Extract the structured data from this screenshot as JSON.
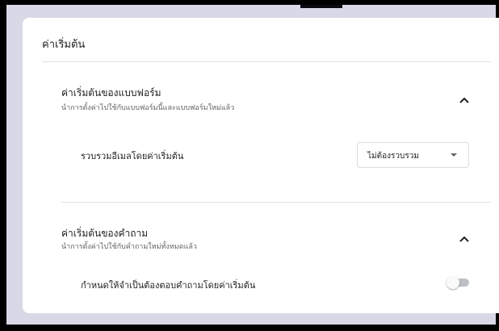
{
  "card": {
    "title": "ค่าเริ่มต้น"
  },
  "form_defaults": {
    "title": "ค่าเริ่มต้นของแบบฟอร์ม",
    "subtitle": "นำการตั้งค่าไปใช้กับแบบฟอร์มนี้และแบบฟอร์มใหม่แล้ว",
    "chevron_icon": "chevron-up-icon",
    "collect_email": {
      "label": "รวบรวมอีเมลโดยค่าเริ่มต้น",
      "selected": "ไม่ต้องรวบรวม",
      "caret_icon": "caret-down-icon"
    }
  },
  "question_defaults": {
    "title": "ค่าเริ่มต้นของคำถาม",
    "subtitle": "นำการตั้งค่าไปใช้กับคำถามใหม่ทั้งหมดแล้ว",
    "chevron_icon": "chevron-up-icon",
    "required_default": {
      "label": "กำหนดให้จำเป็นต้องตอบคำถามโดยค่าเริ่มต้น",
      "enabled": false
    }
  },
  "colors": {
    "background": "#d9d8e6",
    "card": "#ffffff",
    "toggle_off_track": "#bdc1c6"
  }
}
